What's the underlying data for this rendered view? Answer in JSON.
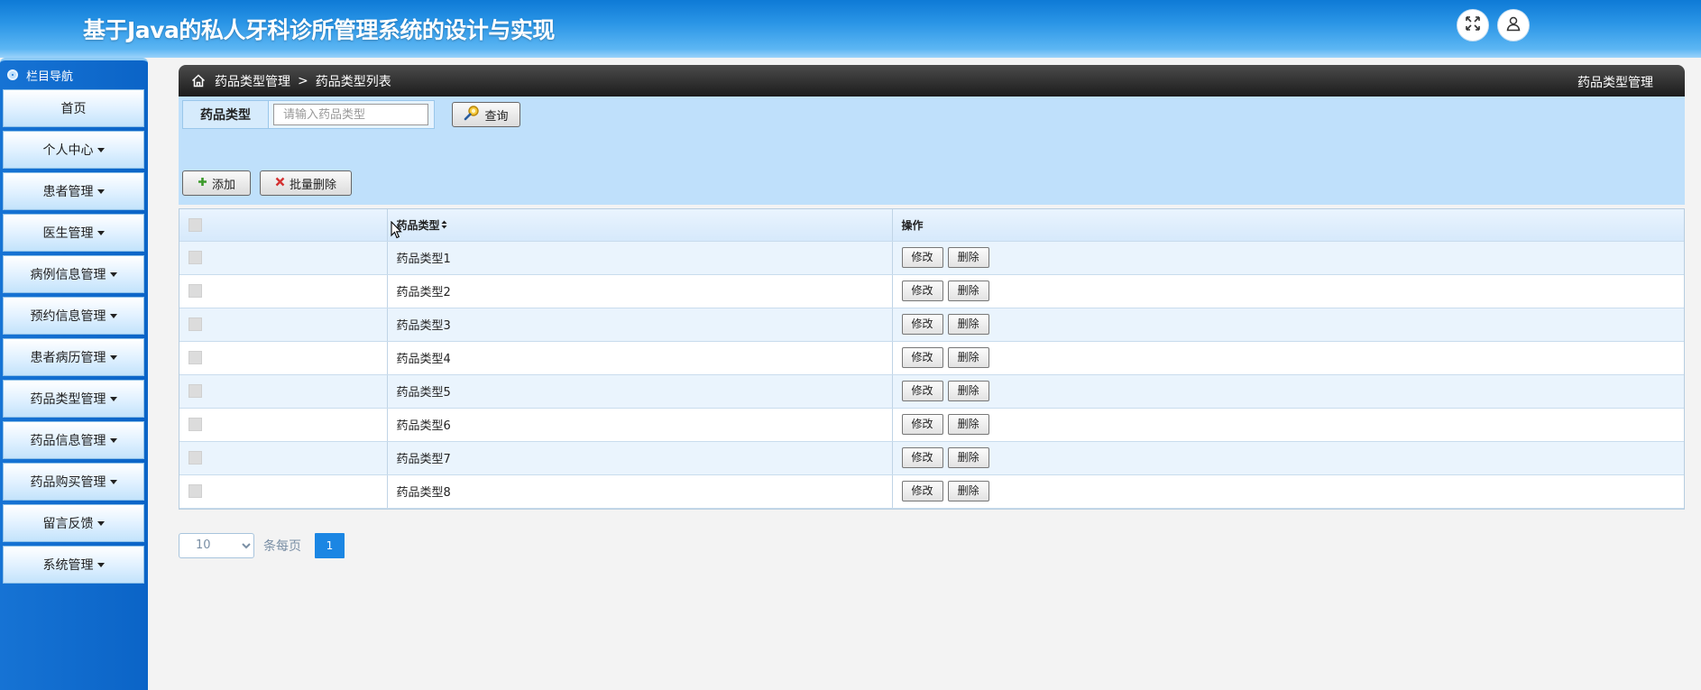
{
  "app": {
    "title": "基于Java的私人牙科诊所管理系统的设计与实现",
    "header_icons": [
      "expand-icon",
      "user-icon"
    ]
  },
  "sidebar": {
    "heading": "栏目导航",
    "items": [
      {
        "label": "首页",
        "has_caret": false
      },
      {
        "label": "个人中心",
        "has_caret": true
      },
      {
        "label": "患者管理",
        "has_caret": true
      },
      {
        "label": "医生管理",
        "has_caret": true
      },
      {
        "label": "病例信息管理",
        "has_caret": true
      },
      {
        "label": "预约信息管理",
        "has_caret": true
      },
      {
        "label": "患者病历管理",
        "has_caret": true
      },
      {
        "label": "药品类型管理",
        "has_caret": true
      },
      {
        "label": "药品信息管理",
        "has_caret": true
      },
      {
        "label": "药品购买管理",
        "has_caret": true
      },
      {
        "label": "留言反馈",
        "has_caret": true
      },
      {
        "label": "系统管理",
        "has_caret": true
      }
    ]
  },
  "breadcrumb": {
    "parent": "药品类型管理",
    "separator": ">",
    "current": "药品类型列表",
    "right_title": "药品类型管理"
  },
  "search": {
    "label": "药品类型",
    "value": "",
    "placeholder": "请输入药品类型",
    "query_button": "查询"
  },
  "actions": {
    "add": "添加",
    "batch_delete": "批量删除"
  },
  "table": {
    "columns": [
      "",
      "药品类型",
      "操作"
    ],
    "rows": [
      {
        "type": "药品类型1"
      },
      {
        "type": "药品类型2"
      },
      {
        "type": "药品类型3"
      },
      {
        "type": "药品类型4"
      },
      {
        "type": "药品类型5"
      },
      {
        "type": "药品类型6"
      },
      {
        "type": "药品类型7"
      },
      {
        "type": "药品类型8"
      }
    ],
    "edit_label": "修改",
    "delete_label": "删除"
  },
  "pagination": {
    "page_size": "10",
    "per_page_label": "条每页",
    "current_page": "1"
  },
  "colors": {
    "header": "#1f8be0",
    "sidebar": "#0f6bcf",
    "search_bg": "#bfe0fb",
    "page_active": "#1b86e3"
  }
}
